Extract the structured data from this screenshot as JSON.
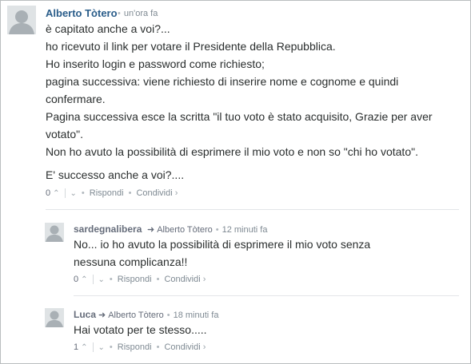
{
  "comments": [
    {
      "author": "Alberto Tòtero",
      "time": "un'ora fa",
      "paragraphs": [
        "è capitato anche a voi?...",
        "ho ricevuto il link per votare il Presidente della Repubblica.",
        "Ho inserito login e password come richiesto;",
        "pagina successiva: viene richiesto di inserire nome e cognome e quindi confermare.",
        "Pagina successiva esce la scritta \"il tuo voto è stato acquisito, Grazie per aver votato\".",
        "Non ho avuto la possibilità di esprimere il mio voto e non so \"chi ho votato\"."
      ],
      "last_paragraph": "E' successo anche a voi?....",
      "votes": "0",
      "reply_label": "Rispondi",
      "share_label": "Condividi"
    },
    {
      "author": "sardegnalibera",
      "reply_to": "Alberto Tòtero",
      "time": "12 minuti fa",
      "paragraphs": [
        "No... io ho avuto la possibilità di esprimere il mio voto senza nessuna complicanza!!"
      ],
      "votes": "0",
      "reply_label": "Rispondi",
      "share_label": "Condividi"
    },
    {
      "author": "Luca",
      "reply_to": "Alberto Tòtero",
      "time": "18 minuti fa",
      "paragraphs": [
        "Hai votato per te stesso....."
      ],
      "votes": "1",
      "reply_label": "Rispondi",
      "share_label": "Condividi"
    }
  ],
  "icons": {
    "upvote": "chevron-up-icon",
    "downvote": "chevron-down-icon",
    "reply_arrow": "reply-arrow-icon",
    "avatar": "default-avatar-icon"
  },
  "colors": {
    "author_link": "#2a5d8a",
    "meta_text": "#7f8a93",
    "body_text": "#2a2e2e",
    "avatar_bg": "#c3c8cc"
  }
}
